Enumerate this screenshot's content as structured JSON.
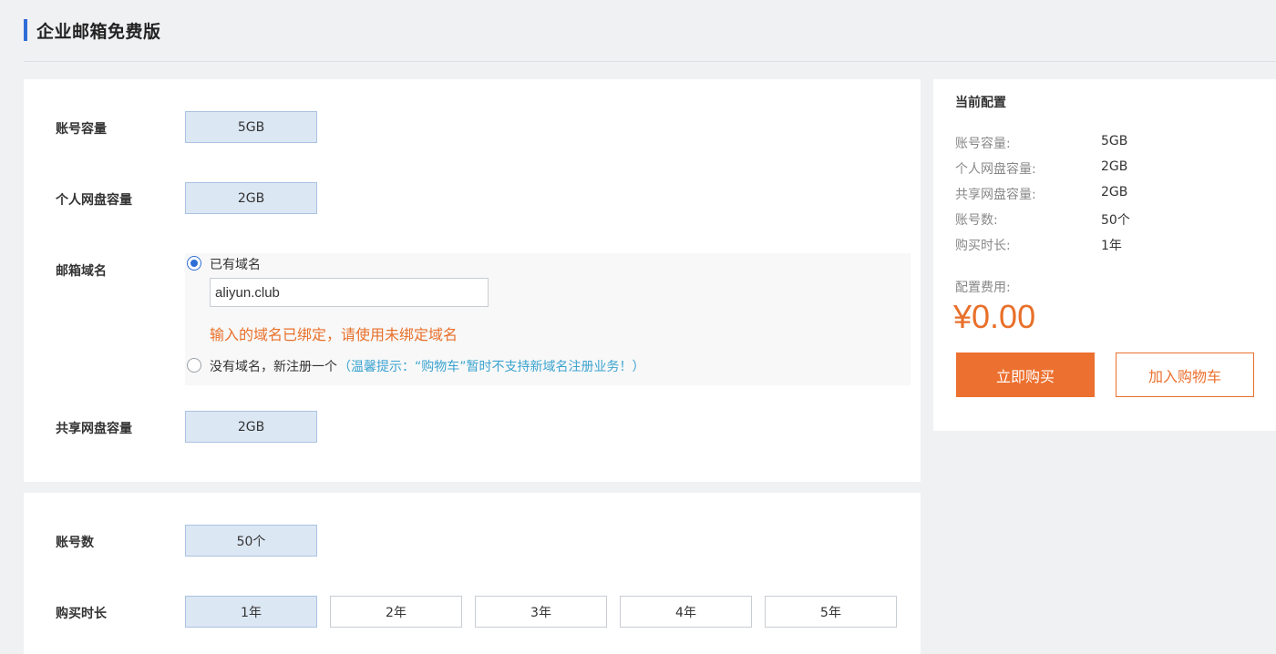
{
  "header": {
    "title": "企业邮箱免费版"
  },
  "main": {
    "account_capacity": {
      "label": "账号容量",
      "value": "5GB"
    },
    "personal_disk": {
      "label": "个人网盘容量",
      "value": "2GB"
    },
    "domain": {
      "label": "邮箱域名",
      "has_domain_label": "已有域名",
      "input_value": "aliyun.club",
      "error": "输入的域名已绑定，请使用未绑定域名",
      "no_domain_label": "没有域名，新注册一个",
      "hint": "（温馨提示：“购物车”暂时不支持新域名注册业务！）"
    },
    "shared_disk": {
      "label": "共享网盘容量",
      "value": "2GB"
    }
  },
  "second": {
    "account_count": {
      "label": "账号数",
      "value": "50个"
    },
    "duration": {
      "label": "购买时长",
      "options": [
        "1年",
        "2年",
        "3年",
        "4年",
        "5年"
      ],
      "selected": "1年"
    }
  },
  "summary": {
    "title": "当前配置",
    "rows": [
      {
        "key": "账号容量:",
        "value": "5GB"
      },
      {
        "key": "个人网盘容量:",
        "value": "2GB"
      },
      {
        "key": "共享网盘容量:",
        "value": "2GB"
      },
      {
        "key": "账号数:",
        "value": "50个"
      },
      {
        "key": "购买时长:",
        "value": "1年"
      }
    ],
    "fee_label": "配置费用:",
    "price": "¥0.00",
    "buy_label": "立即购买",
    "cart_label": "加入购物车"
  },
  "colors": {
    "accent": "#2f6ed6",
    "orange": "#ec702f",
    "selected_bg": "#dce7f4",
    "hint": "#3ba3d0"
  }
}
